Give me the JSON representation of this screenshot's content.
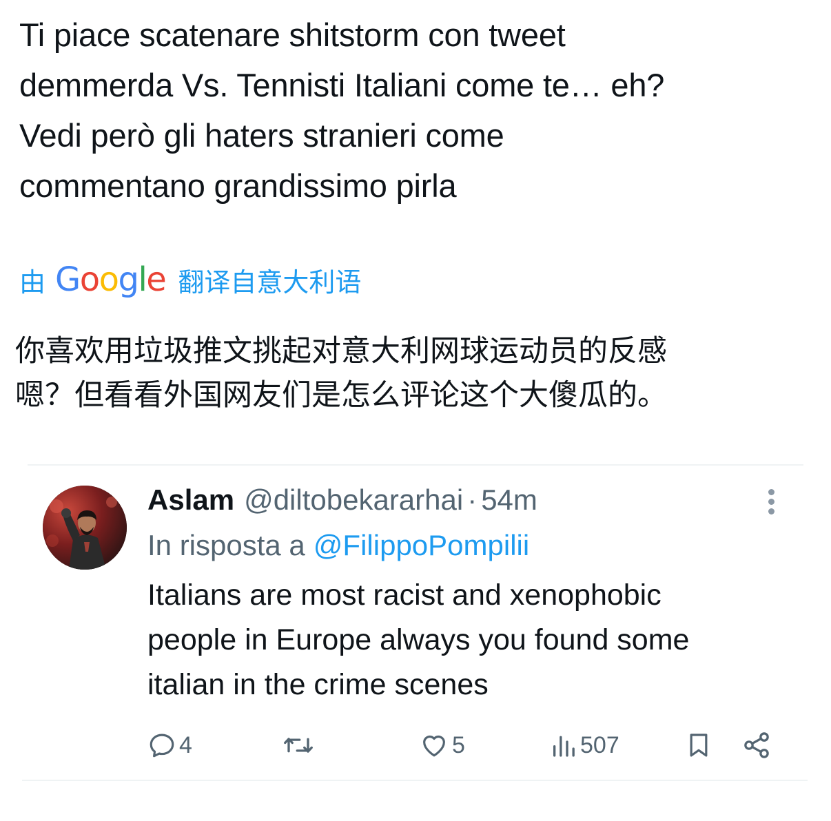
{
  "tweet": {
    "text": "Ti piace scatenare shitstorm con tweet\ndemmerda Vs. Tennisti Italiani come te… eh?\nVedi però gli haters stranieri come\ncommentano grandissimo pirla"
  },
  "translation": {
    "prefix": "由",
    "provider_letters": [
      "G",
      "o",
      "o",
      "g",
      "l",
      "e"
    ],
    "suffix": "翻译自意大利语",
    "text": "你喜欢用垃圾推文挑起对意大利网球运动员的反感\n嗯？但看看外国网友们是怎么评论这个大傻瓜的。"
  },
  "quoted_reply": {
    "avatar_icon": "goalkeeper-avatar",
    "author_name": "Aslam",
    "author_handle": "@diltobekararhai",
    "separator": "·",
    "timestamp": "54m",
    "reply_to_label": "In risposta a",
    "reply_to_handle": "@FilippoPompilii",
    "text": "Italians are most racist and xenophobic\npeople in Europe always you found some\nitalian in the crime scenes",
    "actions": {
      "replies": {
        "icon": "reply-icon",
        "count": "4"
      },
      "retweets": {
        "icon": "retweet-icon",
        "count": ""
      },
      "likes": {
        "icon": "heart-icon",
        "count": "5"
      },
      "views": {
        "icon": "views-icon",
        "count": "507"
      },
      "bookmark": {
        "icon": "bookmark-icon"
      },
      "share": {
        "icon": "share-icon"
      }
    }
  },
  "colors": {
    "text": "#0f1419",
    "secondary": "#536471",
    "link": "#1d9bf0",
    "divider": "#eff3f4",
    "google_blue": "#4285f4",
    "google_red": "#ea4335",
    "google_yellow": "#fbbc05",
    "google_green": "#34a853"
  }
}
